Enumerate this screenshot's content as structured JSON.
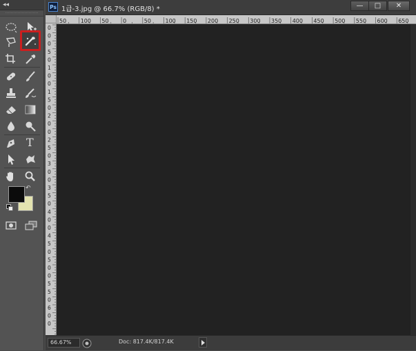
{
  "toolbox": {
    "collapse_label": "◂◂",
    "tools": [
      {
        "id": "ellipse-marquee",
        "icon": "ellipse-marquee-icon"
      },
      {
        "id": "move",
        "icon": "move-icon"
      },
      {
        "id": "polygonal-lasso",
        "icon": "polygonal-lasso-icon"
      },
      {
        "id": "quick-selection",
        "icon": "quick-selection-icon",
        "highlighted": true
      },
      {
        "id": "crop",
        "icon": "crop-icon"
      },
      {
        "id": "eyedropper",
        "icon": "eyedropper-icon"
      },
      {
        "id": "spot-healing",
        "icon": "spot-healing-icon"
      },
      {
        "id": "brush",
        "icon": "brush-icon"
      },
      {
        "id": "clone-stamp",
        "icon": "clone-stamp-icon"
      },
      {
        "id": "history-brush",
        "icon": "history-brush-icon"
      },
      {
        "id": "eraser",
        "icon": "eraser-icon"
      },
      {
        "id": "gradient",
        "icon": "gradient-icon"
      },
      {
        "id": "blur",
        "icon": "blur-icon"
      },
      {
        "id": "dodge",
        "icon": "dodge-icon"
      },
      {
        "id": "pen",
        "icon": "pen-icon"
      },
      {
        "id": "type",
        "icon": "type-icon",
        "glyph": "T"
      },
      {
        "id": "path-selection",
        "icon": "path-selection-icon"
      },
      {
        "id": "custom-shape",
        "icon": "custom-shape-icon"
      },
      {
        "id": "hand",
        "icon": "hand-icon"
      },
      {
        "id": "zoom",
        "icon": "zoom-icon"
      },
      {
        "id": "quick-mask",
        "icon": "quick-mask-icon"
      },
      {
        "id": "screen-mode",
        "icon": "screen-mode-icon"
      }
    ],
    "foreground_color": "#0b0b0b",
    "background_color": "#e3e3b0",
    "highlight_color": "#cc1f1f"
  },
  "document": {
    "app_badge": "Ps",
    "title": "1급-3.jpg @ 66.7% (RGB/8) *",
    "window_buttons": {
      "minimize": "—",
      "maximize": "□",
      "close": "✕"
    },
    "ruler_h_labels": [
      "50",
      "100",
      "50",
      "0",
      "50",
      "100",
      "150",
      "200",
      "250",
      "300",
      "350",
      "400",
      "450",
      "500",
      "550",
      "600",
      "650"
    ],
    "ruler_v_labels": [
      "0",
      "0",
      "0",
      "5",
      "0",
      "1",
      "0",
      "0",
      "1",
      "5",
      "0",
      "2",
      "0",
      "0",
      "2",
      "5",
      "0",
      "3",
      "0",
      "0",
      "3",
      "5",
      "0",
      "4",
      "0",
      "0",
      "4",
      "5",
      "0",
      "5",
      "0",
      "0",
      "5",
      "5",
      "0",
      "6",
      "0",
      "0"
    ],
    "zoom": "66.67%",
    "doc_info": "Doc: 817.4K/817.4K"
  }
}
